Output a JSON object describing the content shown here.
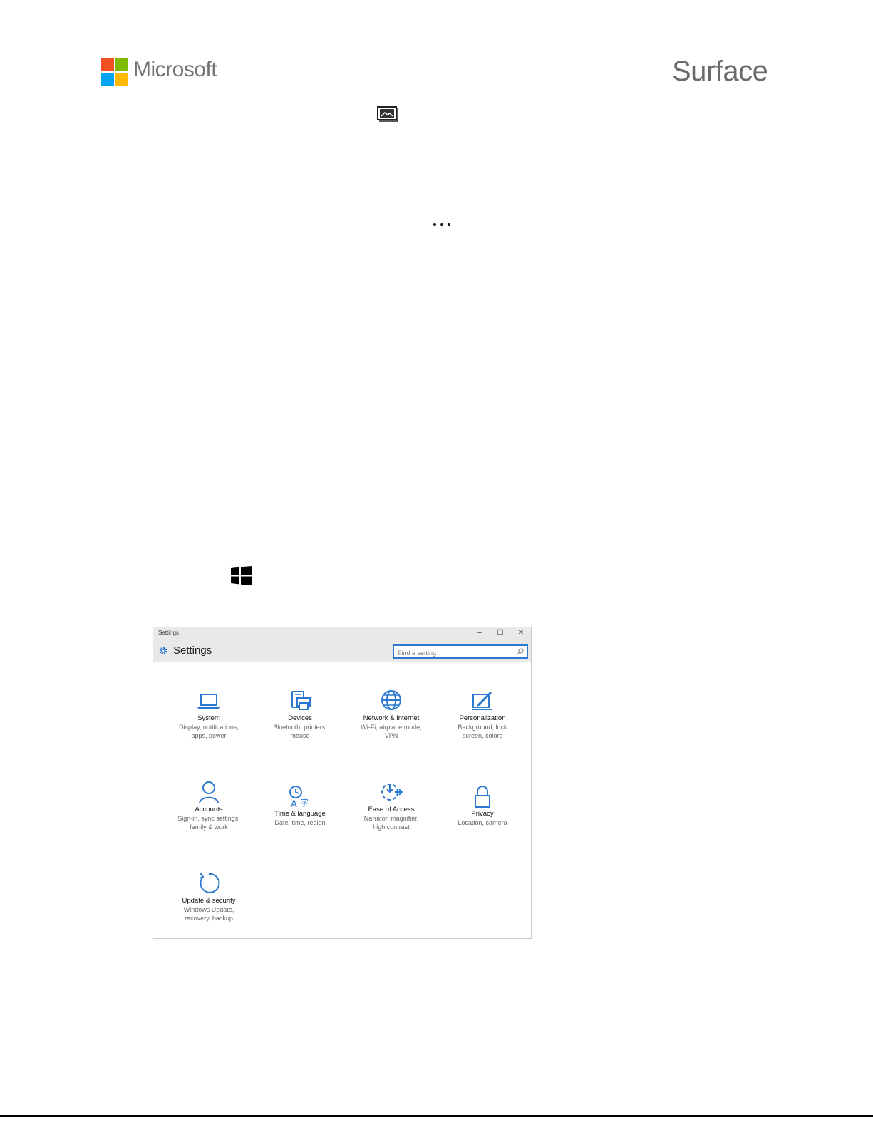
{
  "header": {
    "microsoft_wordmark": "Microsoft",
    "surface_wordmark": "Surface",
    "logo_colors": [
      "#f25022",
      "#7fba00",
      "#00a4ef",
      "#ffb900"
    ]
  },
  "icons": {
    "photos": "photos-icon",
    "more": "more-icon",
    "start": "windows-start-icon"
  },
  "settings_window": {
    "titlebar_title": "Settings",
    "minimize_glyph": "–",
    "maximize_glyph": "☐",
    "close_glyph": "✕",
    "header_title": "Settings",
    "search_placeholder": "Find a setting",
    "accent_color": "#2b78d0",
    "tiles": [
      {
        "name": "System",
        "desc": [
          "Display, notifications,",
          "apps, power"
        ],
        "icon": "laptop-icon"
      },
      {
        "name": "Devices",
        "desc": [
          "Bluetooth, printers,",
          "mouse"
        ],
        "icon": "printer-icon"
      },
      {
        "name": "Network & Internet",
        "desc": [
          "Wi-Fi, airplane mode,",
          "VPN"
        ],
        "icon": "globe-icon"
      },
      {
        "name": "Personalization",
        "desc": [
          "Background, lock",
          "screen, colors"
        ],
        "icon": "paint-icon"
      },
      {
        "name": "Accounts",
        "desc": [
          "Sign-in, sync settings,",
          "family & work"
        ],
        "icon": "person-icon"
      },
      {
        "name": "Time & language",
        "desc": [
          "Date, time, region"
        ],
        "icon": "time-language-icon"
      },
      {
        "name": "Ease of Access",
        "desc": [
          "Narrator, magnifier,",
          "high contrast"
        ],
        "icon": "ease-of-access-icon"
      },
      {
        "name": "Privacy",
        "desc": [
          "Location, camera"
        ],
        "icon": "lock-icon"
      },
      {
        "name": "Update & security",
        "desc": [
          "Windows Update,",
          "recovery, backup"
        ],
        "icon": "update-icon"
      }
    ]
  }
}
